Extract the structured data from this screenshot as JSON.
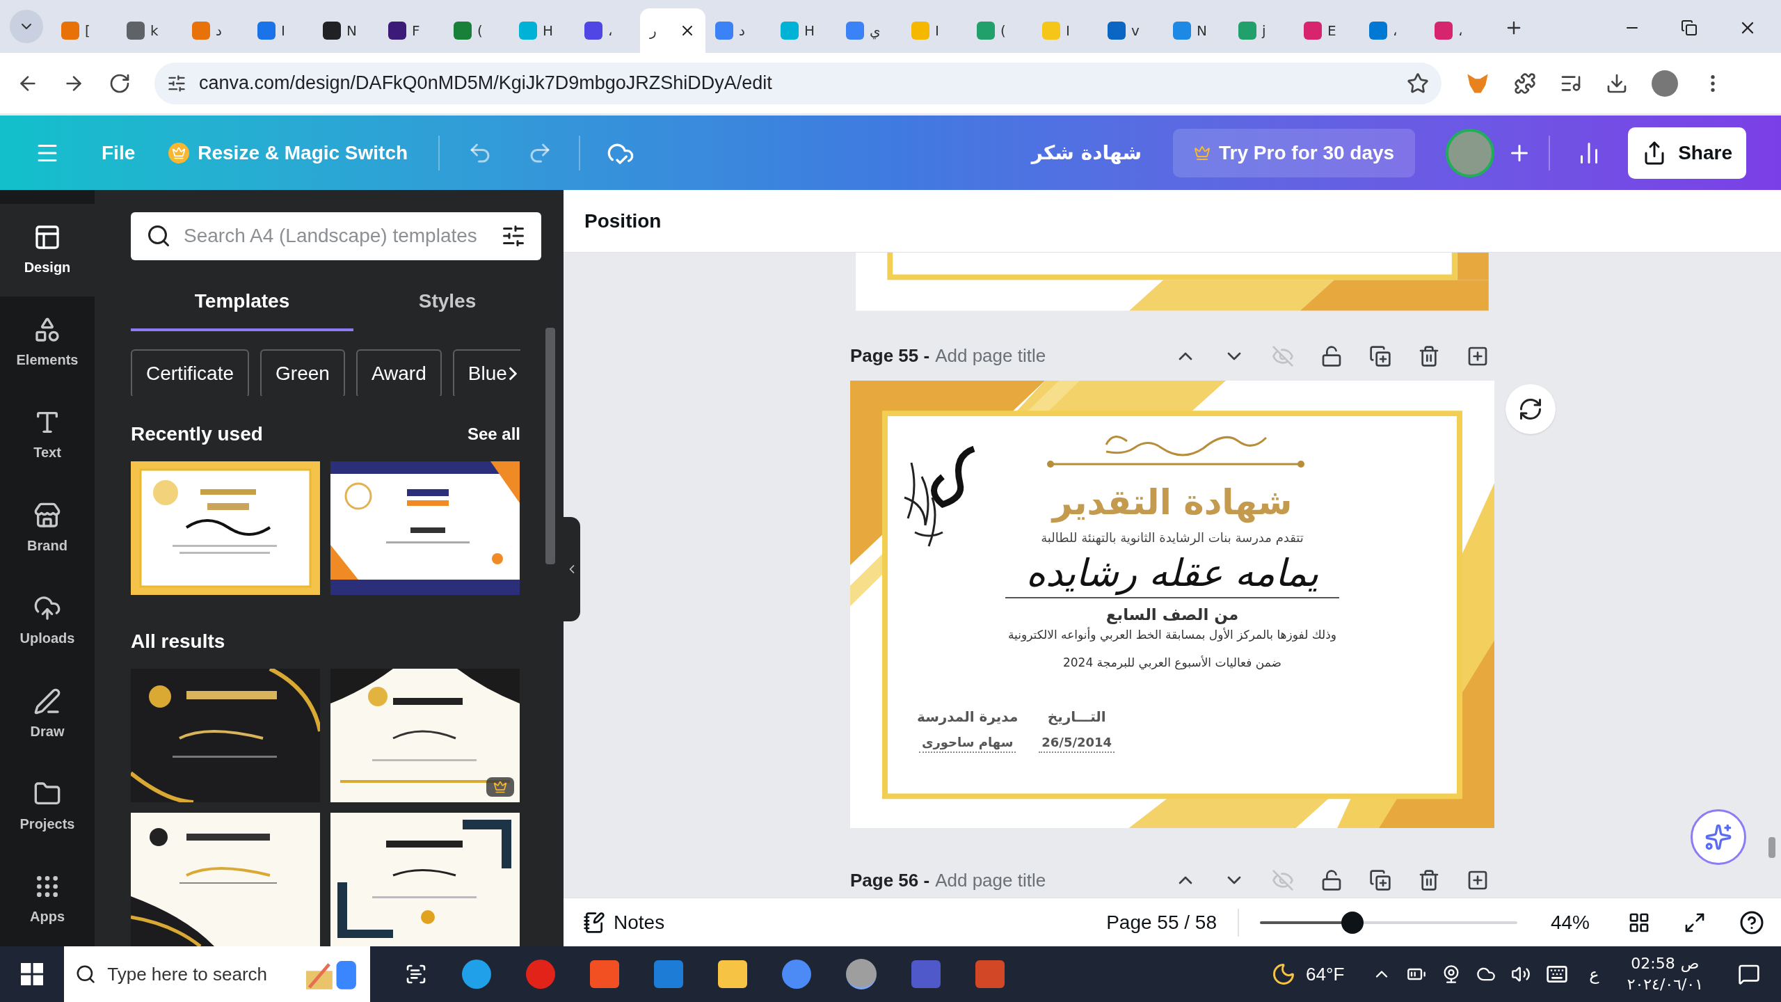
{
  "browser": {
    "tabs": [
      {
        "label": "[",
        "color": "#e8710a",
        "selected": false
      },
      {
        "label": "k",
        "color": "#5f6368",
        "selected": false
      },
      {
        "label": "د",
        "color": "#e8710a",
        "selected": false
      },
      {
        "label": "I",
        "color": "#1a73e8",
        "selected": false
      },
      {
        "label": "N",
        "color": "#202124",
        "selected": false
      },
      {
        "label": "F",
        "color": "#3c1a78",
        "selected": false
      },
      {
        "label": "(",
        "color": "#188038",
        "selected": false
      },
      {
        "label": "H",
        "color": "#00b3d6",
        "selected": false
      },
      {
        "label": "،",
        "color": "#4f46e5",
        "selected": false
      },
      {
        "label": "ر",
        "selected": true
      },
      {
        "label": "د",
        "color": "#3b82f6",
        "selected": false
      },
      {
        "label": "H",
        "color": "#00b3d6",
        "selected": false
      },
      {
        "label": "ي",
        "color": "#3b82f6",
        "selected": false
      },
      {
        "label": "I",
        "color": "#f5b700",
        "selected": false
      },
      {
        "label": "(",
        "color": "#22a06b",
        "selected": false
      },
      {
        "label": "I",
        "color": "#f5c518",
        "selected": false
      },
      {
        "label": "v",
        "color": "#0a66c2",
        "selected": false
      },
      {
        "label": "N",
        "color": "#1e88e5",
        "selected": false
      },
      {
        "label": "j",
        "color": "#22a06b",
        "selected": false
      },
      {
        "label": "E",
        "color": "#d6246e",
        "selected": false
      },
      {
        "label": "،",
        "color": "#0078d4",
        "selected": false
      },
      {
        "label": "،",
        "color": "#d6246e",
        "selected": false
      }
    ],
    "address": "canva.com/design/DAFkQ0nMD5M/KgiJk7D9mbgoJRZShiDDyA/edit"
  },
  "header": {
    "file": "File",
    "resize": "Resize & Magic Switch",
    "title": "شهادة شكر",
    "pro": "Try Pro for 30 days",
    "share": "Share"
  },
  "rail": [
    {
      "label": "Design",
      "selected": true
    },
    {
      "label": "Elements",
      "selected": false
    },
    {
      "label": "Text",
      "selected": false
    },
    {
      "label": "Brand",
      "selected": false
    },
    {
      "label": "Uploads",
      "selected": false
    },
    {
      "label": "Draw",
      "selected": false
    },
    {
      "label": "Projects",
      "selected": false
    },
    {
      "label": "Apps",
      "selected": false
    }
  ],
  "panel": {
    "search": {
      "placeholder": "Search A4 (Landscape) templates"
    },
    "tabs": [
      {
        "label": "Templates",
        "selected": true
      },
      {
        "label": "Styles",
        "selected": false
      }
    ],
    "chips": [
      "Certificate",
      "Green",
      "Award",
      "Blue"
    ],
    "recent": {
      "title": "Recently used",
      "link": "See all"
    },
    "all": {
      "title": "All results"
    }
  },
  "toolbar": {
    "label": "Position"
  },
  "pages": [
    {
      "number": "Page 55 -",
      "placeholder": "Add page title"
    },
    {
      "number": "Page 56 -",
      "placeholder": "Add page title"
    }
  ],
  "certificate": {
    "title": "شهادة التقدير",
    "intro": "تتقدم مدرسة بنات الرشايدة الثانوية بالتهنئة للطالبة",
    "name": "يمامه عقله رشايده",
    "grade": "من الصف السابع",
    "reason": "وذلك لفوزها بالمركز الأول بمسابقة الخط العربي وأنواعه الالكترونية",
    "event": "ضمن فعاليات الأسبوع العربي للبرمجة 2024",
    "principal": {
      "label": "مديرة المدرسة",
      "value": "سهام ساحورى"
    },
    "date": {
      "label": "التـــاريخ",
      "value": "26/5/2014"
    }
  },
  "bottom": {
    "notes": "Notes",
    "page": "Page 55 / 58",
    "zoom": {
      "level": 0.36
    },
    "percent": "44%"
  },
  "taskbar": {
    "search": {
      "placeholder": "Type here to search"
    },
    "weather": "64°F",
    "lang": "ع",
    "time": "02:58",
    "period": "ص",
    "date": "٢٠٢٤/٠٦/٠١"
  }
}
